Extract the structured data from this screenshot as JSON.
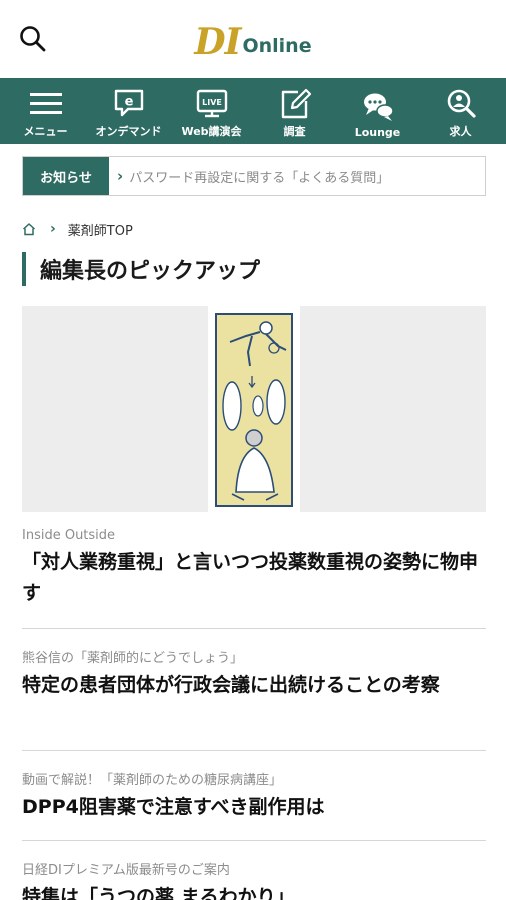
{
  "header": {
    "logo_primary": "DI",
    "logo_secondary": "Online"
  },
  "nav": {
    "items": [
      {
        "label": "メニュー",
        "icon": "hamburger-menu-icon"
      },
      {
        "label": "オンデマンド",
        "icon": "on-demand-icon"
      },
      {
        "label": "Web講演会",
        "icon": "live-icon"
      },
      {
        "label": "調査",
        "icon": "survey-pencil-icon"
      },
      {
        "label": "Lounge",
        "icon": "chat-bubbles-icon"
      },
      {
        "label": "求人",
        "icon": "job-search-icon"
      }
    ]
  },
  "notice": {
    "badge": "お知らせ",
    "text": "パスワード再設定に関する「よくある質問」"
  },
  "breadcrumb": {
    "current": "薬剤師TOP"
  },
  "section": {
    "title": "編集長のピックアップ"
  },
  "articles": [
    {
      "category": "Inside Outside",
      "title": "「対人業務重視」と言いつつ投薬数重視の姿勢に物申す"
    },
    {
      "category": "熊谷信の「薬剤師的にどうでしょう」",
      "title": "特定の患者団体が行政会議に出続けることの考察"
    },
    {
      "category": "動画で解説！「薬剤師のための糖尿病講座」",
      "title": "DPP4阻害薬で注意すべき副作用は"
    },
    {
      "category": "日経DIプレミアム版最新号のご案内",
      "title": "特集は「うつの薬 まるわかり」"
    }
  ],
  "colors": {
    "brand_green": "#2e6b63",
    "brand_gold": "#c9a227"
  }
}
